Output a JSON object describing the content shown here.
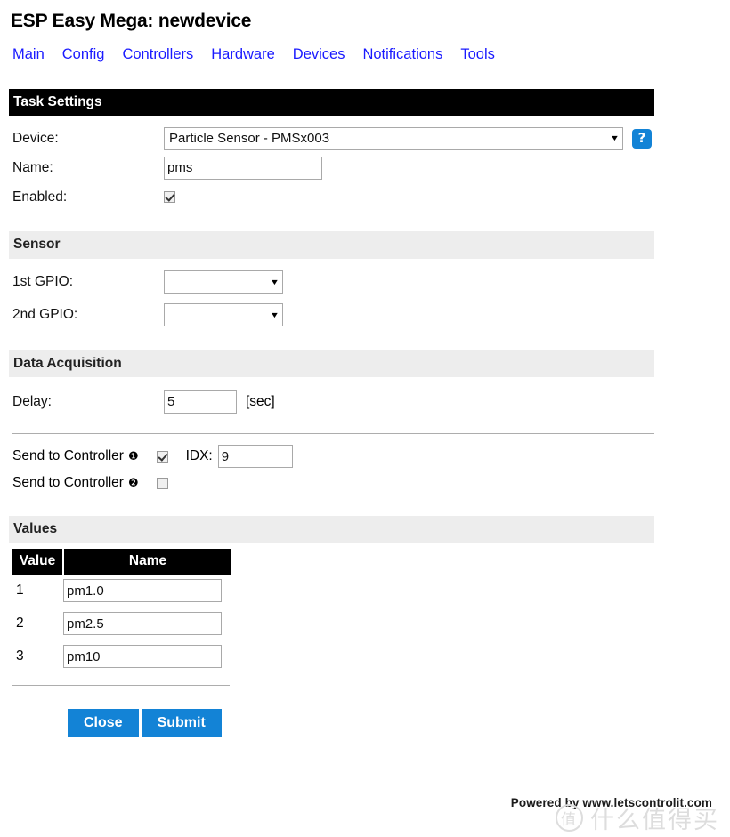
{
  "header": {
    "title": "ESP Easy Mega: newdevice"
  },
  "nav": {
    "items": [
      {
        "label": "Main",
        "active": false
      },
      {
        "label": "Config",
        "active": false
      },
      {
        "label": "Controllers",
        "active": false
      },
      {
        "label": "Hardware",
        "active": false
      },
      {
        "label": "Devices",
        "active": true
      },
      {
        "label": "Notifications",
        "active": false
      },
      {
        "label": "Tools",
        "active": false
      }
    ]
  },
  "sections": {
    "task_settings": "Task Settings",
    "sensor": "Sensor",
    "data_acquisition": "Data Acquisition",
    "values": "Values"
  },
  "task": {
    "device_label": "Device:",
    "device_value": "Particle Sensor - PMSx003",
    "help_glyph": "?",
    "name_label": "Name:",
    "name_value": "pms",
    "name_placeholder": "",
    "enabled_label": "Enabled:",
    "enabled_checked": true
  },
  "sensor": {
    "gpio1_label": "1st GPIO:",
    "gpio1_value": "",
    "gpio2_label": "2nd GPIO:",
    "gpio2_value": ""
  },
  "acquisition": {
    "delay_label": "Delay:",
    "delay_value": "5",
    "delay_unit": "[sec]",
    "controllers": [
      {
        "label": "Send to Controller",
        "badge": "❶",
        "checked": true,
        "idx_label": "IDX:",
        "idx_value": "9",
        "has_idx": true
      },
      {
        "label": "Send to Controller",
        "badge": "❷",
        "checked": false,
        "idx_label": "",
        "idx_value": "",
        "has_idx": false
      }
    ]
  },
  "values_table": {
    "columns": [
      "Value",
      "Name"
    ],
    "rows": [
      {
        "index": "1",
        "name": "pm1.0"
      },
      {
        "index": "2",
        "name": "pm2.5"
      },
      {
        "index": "3",
        "name": "pm10"
      }
    ]
  },
  "buttons": {
    "close": "Close",
    "submit": "Submit"
  },
  "footer": {
    "text": "Powered by www.letscontrolit.com"
  },
  "watermark": {
    "mark": "值",
    "text": "什么值得买"
  },
  "colors": {
    "link": "#1a1aff",
    "accent": "#1383d6",
    "section_dark": "#000000",
    "section_light": "#ededed"
  }
}
